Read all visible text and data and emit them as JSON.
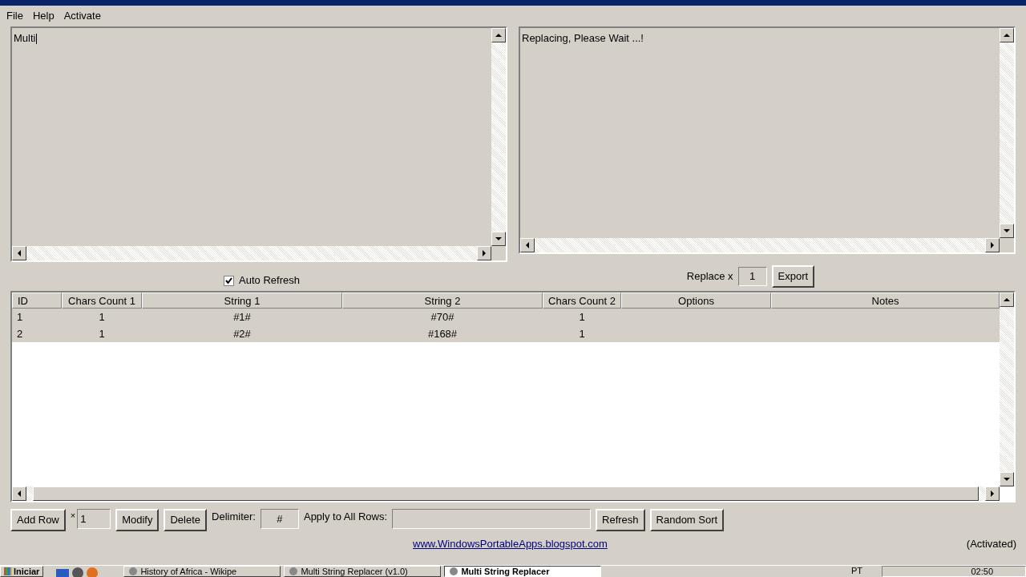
{
  "menu": [
    "File",
    "Help",
    "Activate"
  ],
  "source_text": "Multi",
  "output_text": "Replacing, Please Wait ...!",
  "auto_refresh": {
    "label": "Auto Refresh",
    "checked": true
  },
  "replace": {
    "label": "Replace x",
    "value": "1",
    "button": "Export"
  },
  "table": {
    "columns": [
      "ID",
      "Chars Count 1",
      "String 1",
      "String 2",
      "Chars Count 2",
      "Options",
      "Notes"
    ],
    "rows": [
      [
        "1",
        "1",
        "#1#",
        "#70#",
        "1",
        "",
        ""
      ],
      [
        "2",
        "1",
        "#2#",
        "#168#",
        "1",
        "",
        ""
      ]
    ]
  },
  "toolbar": {
    "add_row": "Add Row",
    "times": "×",
    "count": "1",
    "modify": "Modify",
    "delete": "Delete",
    "delimiter_label": "Delimiter:",
    "delimiter": "#",
    "apply_label": "Apply to All Rows:",
    "refresh": "Refresh",
    "random_sort": "Random Sort"
  },
  "link": "www.WindowsPortableApps.blogspot.com",
  "status": "(Activated)",
  "taskbar": {
    "start": "Iniciar",
    "tasks": [
      {
        "label": "History of Africa - Wikipe",
        "selected": false
      },
      {
        "label": "Multi String Replacer (v1.0)",
        "selected": false
      },
      {
        "label": "Multi String Replacer",
        "selected": true
      }
    ],
    "language": "PT",
    "clock": "02:50"
  }
}
